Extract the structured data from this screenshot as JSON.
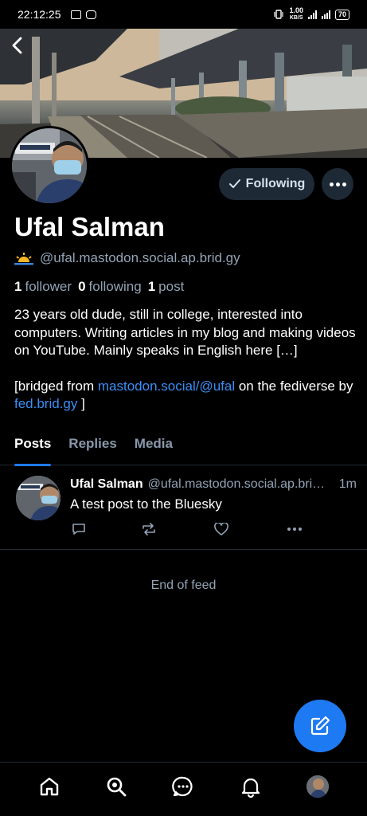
{
  "status_bar": {
    "time": "22:12:25",
    "net_speed_value": "1.00",
    "net_speed_unit": "KB/S",
    "battery": "70"
  },
  "profile": {
    "display_name": "Ufal Salman",
    "handle": "@ufal.mastodon.social.ap.brid.gy",
    "follow_button_label": "Following",
    "followers_count": "1",
    "followers_label": "follower",
    "following_count": "0",
    "following_label": "following",
    "posts_count": "1",
    "posts_label": "post",
    "bio_line1": "23 years old dude, still in college, interested into computers. Writing articles in my blog and making videos on YouTube. Mainly speaks in English here […]",
    "bio_bridged_prefix": "[bridged from ",
    "bio_bridged_link": "mastodon.social/@ufal",
    "bio_bridged_middle": " on the fediverse by ",
    "bio_bridged_link2": "fed.brid.gy",
    "bio_bridged_suffix": " ]"
  },
  "tabs": [
    {
      "label": "Posts",
      "active": true
    },
    {
      "label": "Replies",
      "active": false
    },
    {
      "label": "Media",
      "active": false
    }
  ],
  "posts": [
    {
      "author": "Ufal Salman",
      "handle": "@ufal.mastodon.social.ap.bri…",
      "time": "1m",
      "text": "A test post to the Bluesky"
    }
  ],
  "feed_end_text": "End of feed",
  "colors": {
    "accent": "#1d7af2",
    "link": "#3b8ff5",
    "muted": "#93a3b5",
    "button_bg": "#1e2936"
  },
  "nav": [
    "home-icon",
    "search-icon",
    "chat-icon",
    "bell-icon",
    "profile-avatar"
  ]
}
